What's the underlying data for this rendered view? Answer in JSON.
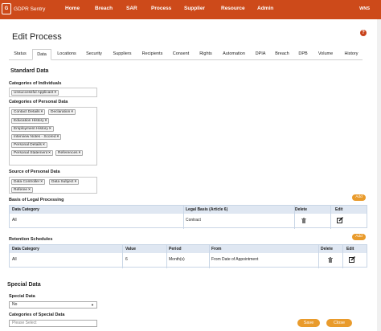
{
  "app": {
    "logo_letter": "G",
    "name": "GDPR Sentry",
    "user": "WNS"
  },
  "nav": [
    "Home",
    "Breach",
    "SAR",
    "Process",
    "Supplier",
    "Resource",
    "Admin"
  ],
  "page": {
    "title": "Edit Process",
    "help_icon": "?"
  },
  "tabs": [
    "Status",
    "Data",
    "Locations",
    "Security",
    "Suppliers",
    "Recipients",
    "Consent",
    "Rights",
    "Automation",
    "DPIA",
    "Breach",
    "DPB",
    "Volume",
    "History"
  ],
  "active_tab": "Data",
  "standard": {
    "heading": "Standard Data",
    "individuals_label": "Categories of Individuals",
    "individuals": [
      "Unsuccessful Applicant"
    ],
    "personal_label": "Categories of Personal Data",
    "personal": [
      "Contact Details",
      "Declaration",
      "Education History",
      "Employment History",
      "Interview Notes - Scored",
      "Personal Details",
      "Personal Statement",
      "References"
    ],
    "source_label": "Source of Personal Data",
    "source": [
      "Data Controller",
      "Data Subject",
      "Referee"
    ]
  },
  "legal": {
    "heading": "Basis of Legal Processing",
    "add_label": "Add",
    "columns": [
      "Data Category",
      "Legal Basis (Article 6)",
      "Delete",
      "Edit"
    ],
    "rows": [
      {
        "category": "All",
        "basis": "Contract"
      }
    ]
  },
  "retention": {
    "heading": "Retention Schedules",
    "add_label": "Add",
    "columns": [
      "Data Category",
      "Value",
      "Period",
      "From",
      "Delete",
      "Edit"
    ],
    "rows": [
      {
        "category": "All",
        "value": "6",
        "period": "Month(s)",
        "from": "From Date of Appointment"
      }
    ]
  },
  "special": {
    "heading": "Special Data",
    "special_label": "Special Data",
    "special_value": "No",
    "categories_label": "Categories of Special Data",
    "categories_placeholder": "Please Select"
  },
  "footer": {
    "save": "Save",
    "close": "Close"
  },
  "colors": {
    "topbar": "#cd4a1a",
    "accent": "#e99b2c",
    "table_header": "#dfe7f2"
  }
}
